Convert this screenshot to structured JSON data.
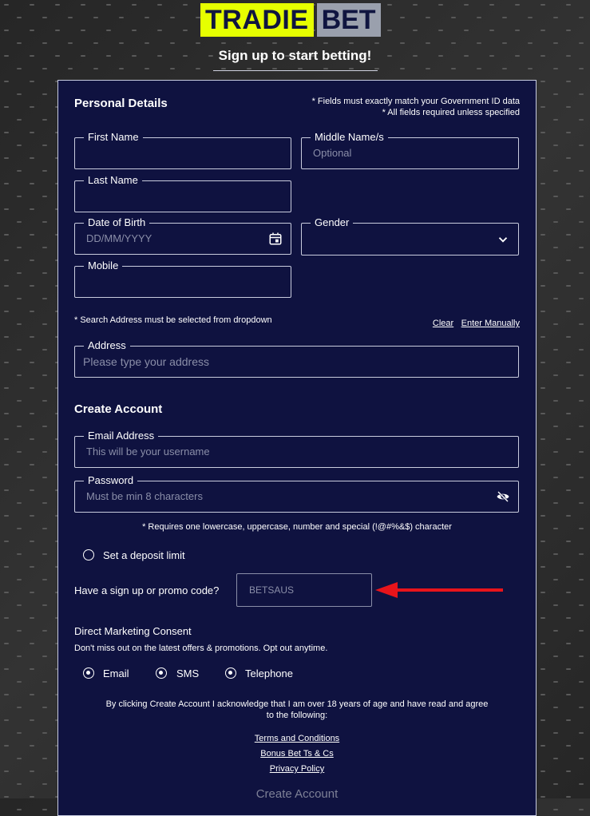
{
  "brand": {
    "left": "TRADIE",
    "right": "BET"
  },
  "tagline": "Sign up to start betting!",
  "personal": {
    "title": "Personal Details",
    "note1": "* Fields must exactly match your Government ID data",
    "note2": "* All fields required unless specified",
    "first_name_label": "First Name",
    "middle_name_label": "Middle Name/s",
    "middle_name_placeholder": "Optional",
    "last_name_label": "Last Name",
    "dob_label": "Date of Birth",
    "dob_placeholder": "DD/MM/YYYY",
    "gender_label": "Gender",
    "mobile_label": "Mobile"
  },
  "address": {
    "note": "* Search Address must be selected from dropdown",
    "clear": "Clear",
    "manual": "Enter Manually",
    "label": "Address",
    "placeholder": "Please type your address"
  },
  "account": {
    "title": "Create Account",
    "email_label": "Email Address",
    "email_placeholder": "This will be your username",
    "password_label": "Password",
    "password_placeholder": "Must be min 8 characters",
    "password_note": "* Requires one lowercase, uppercase, number and special (!@#%&$) character"
  },
  "deposit_limit": "Set a deposit limit",
  "promo": {
    "label": "Have a sign up or promo code?",
    "value": "BETSAUS"
  },
  "marketing": {
    "title": "Direct Marketing Consent",
    "subtitle": "Don't miss out on the latest offers & promotions. Opt out anytime.",
    "options": [
      "Email",
      "SMS",
      "Telephone"
    ]
  },
  "legal": {
    "text": "By clicking Create Account I acknowledge that I am over 18 years of age and have read and agree to the following:",
    "links": [
      "Terms and Conditions",
      "Bonus Bet Ts & Cs",
      "Privacy Policy"
    ]
  },
  "submit": "Create Account",
  "colors": {
    "brand_yellow": "#e6ff00",
    "card_navy": "#0f1240",
    "arrow_red": "#e8141b"
  }
}
